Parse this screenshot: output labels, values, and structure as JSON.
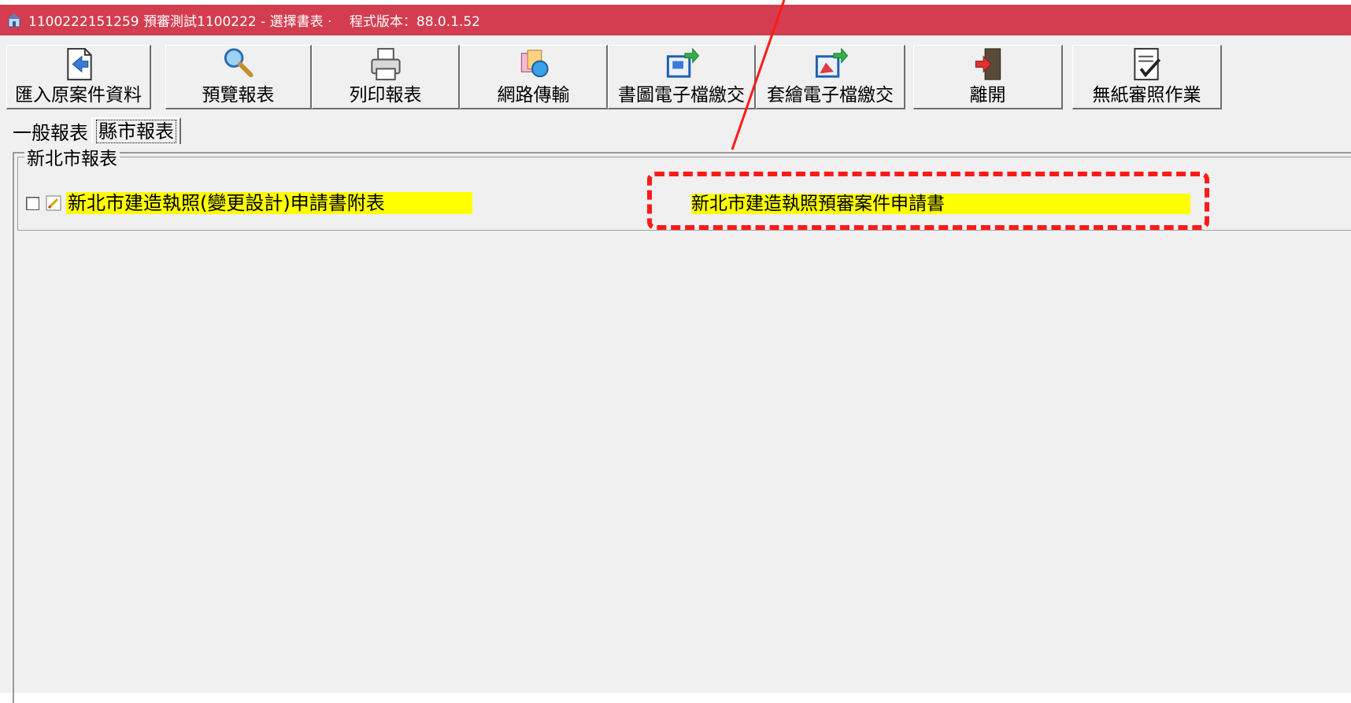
{
  "window": {
    "title": "1100222151259 預審測試1100222 - 選擇書表 ‧ 　程式版本：88.0.1.52"
  },
  "toolbar": {
    "buttons": [
      {
        "label": "匯入原案件資料",
        "icon": "import-icon"
      },
      {
        "label": "預覽報表",
        "icon": "magnifier-icon"
      },
      {
        "label": "列印報表",
        "icon": "printer-icon"
      },
      {
        "label": "網路傳輸",
        "icon": "network-icon"
      },
      {
        "label": "書圖電子檔繳交",
        "icon": "drawing-upload-icon"
      },
      {
        "label": "套繪電子檔繳交",
        "icon": "overlay-upload-icon"
      },
      {
        "label": "離開",
        "icon": "exit-icon"
      },
      {
        "label": "無紙審照作業",
        "icon": "checklist-icon"
      }
    ]
  },
  "tabs": [
    {
      "label": "一般報表",
      "active": false
    },
    {
      "label": "縣市報表",
      "active": true
    }
  ],
  "group": {
    "title": "新北市報表",
    "items": [
      {
        "label": "新北市建造執照(變更設計)申請書附表",
        "checked": false
      }
    ]
  },
  "annotation": {
    "label": "新北市建造執照預審案件申請書",
    "color": "#ff1a1a"
  },
  "colors": {
    "titlebar": "#d33d4f",
    "highlight": "#ffff00",
    "window_bg": "#f0f0f0"
  }
}
